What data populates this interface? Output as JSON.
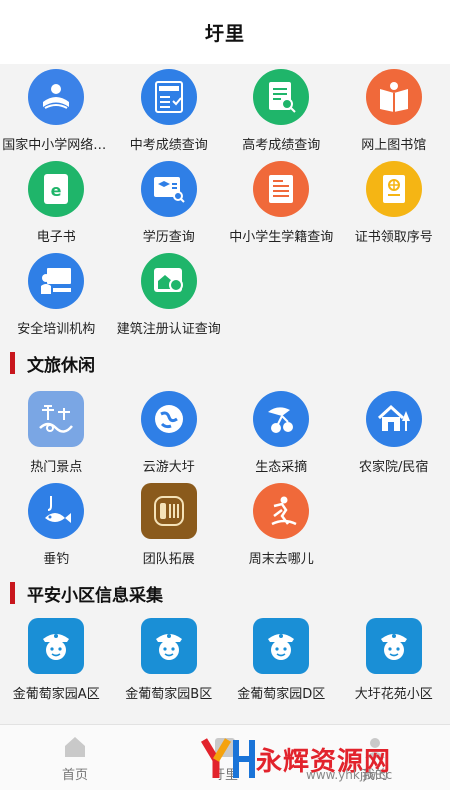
{
  "header": {
    "title": "圩里"
  },
  "education": [
    {
      "label": "国家中小学网络云平台",
      "icon": "school-book-icon",
      "color": "#3b82e8"
    },
    {
      "label": "中考成绩查询",
      "icon": "exam-score-icon",
      "color": "#2f7fe6"
    },
    {
      "label": "高考成绩查询",
      "icon": "score-search-icon",
      "color": "#1fb56a"
    },
    {
      "label": "网上图书馆",
      "icon": "library-book-icon",
      "color": "#f0693a"
    },
    {
      "label": "电子书",
      "icon": "ebook-icon",
      "color": "#1fb56a"
    },
    {
      "label": "学历查询",
      "icon": "degree-search-icon",
      "color": "#2f7fe6"
    },
    {
      "label": "中小学生学籍查询",
      "icon": "student-record-icon",
      "color": "#f0693a"
    },
    {
      "label": "证书领取序号",
      "icon": "certificate-icon",
      "color": "#f5b514"
    },
    {
      "label": "安全培训机构",
      "icon": "training-icon",
      "color": "#2f7fe6"
    },
    {
      "label": "建筑注册认证查询",
      "icon": "building-cert-icon",
      "color": "#1fb56a"
    }
  ],
  "sections": {
    "leisure": "文旅休闲",
    "community": "平安小区信息采集"
  },
  "leisure": [
    {
      "label": "热门景点",
      "icon": "scenic-spot-icon",
      "color": "#7aa6e4"
    },
    {
      "label": "云游大圩",
      "icon": "cloud-tour-icon",
      "color": "#2f7fe6"
    },
    {
      "label": "生态采摘",
      "icon": "fruit-picking-icon",
      "color": "#2f7fe6"
    },
    {
      "label": "农家院/民宿",
      "icon": "farmhouse-icon",
      "color": "#2f7fe6"
    },
    {
      "label": "垂钓",
      "icon": "fishing-icon",
      "color": "#2f7fe6"
    },
    {
      "label": "团队拓展",
      "icon": "team-building-icon",
      "color": "#8a5a1c"
    },
    {
      "label": "周末去哪儿",
      "icon": "weekend-trip-icon",
      "color": "#f0693a"
    }
  ],
  "community": [
    {
      "label": "金葡萄家园A区",
      "icon": "police-icon",
      "color": "#1a8fd6"
    },
    {
      "label": "金葡萄家园B区",
      "icon": "police-icon",
      "color": "#1a8fd6"
    },
    {
      "label": "金葡萄家园D区",
      "icon": "police-icon",
      "color": "#1a8fd6"
    },
    {
      "label": "大圩花苑小区",
      "icon": "police-icon",
      "color": "#1a8fd6"
    }
  ],
  "tabbar": [
    {
      "label": "首页",
      "icon": "home-icon"
    },
    {
      "label": "圩里",
      "icon": "district-icon"
    },
    {
      "label": "我的",
      "icon": "user-icon"
    }
  ],
  "watermark": {
    "text": "永辉资源网",
    "url": "www.yhkjjw.cc"
  }
}
